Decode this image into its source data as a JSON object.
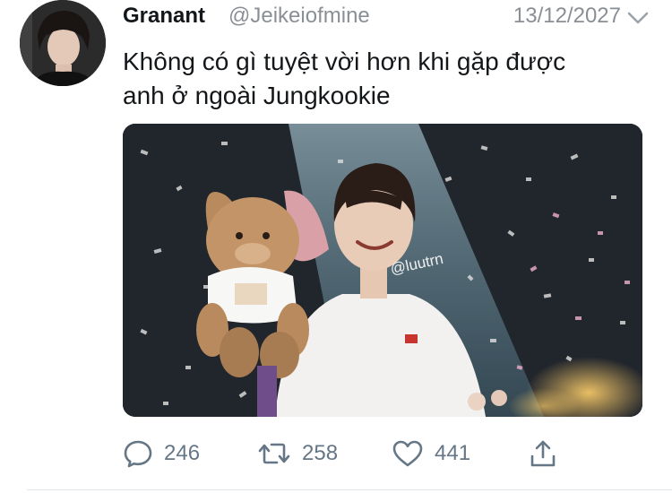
{
  "tweet": {
    "author_name": "Granant",
    "author_handle": "@Jeikeiofmine",
    "date": "13/12/2027",
    "text_line1": "Không có gì tuyệt vời hơn khi gặp được",
    "text_line2": "anh ở ngoài Jungkookie",
    "media_watermark": "@luutrn"
  },
  "actions": {
    "reply_count": "246",
    "retweet_count": "258",
    "like_count": "441"
  },
  "icons": {
    "reply": "reply-icon",
    "retweet": "retweet-icon",
    "like": "heart-icon",
    "share": "share-icon",
    "menu": "chevron-down-icon"
  },
  "colors": {
    "name": "#14171a",
    "secondary": "#8a8f95",
    "action": "#657786",
    "divider": "#e1e8ed"
  }
}
